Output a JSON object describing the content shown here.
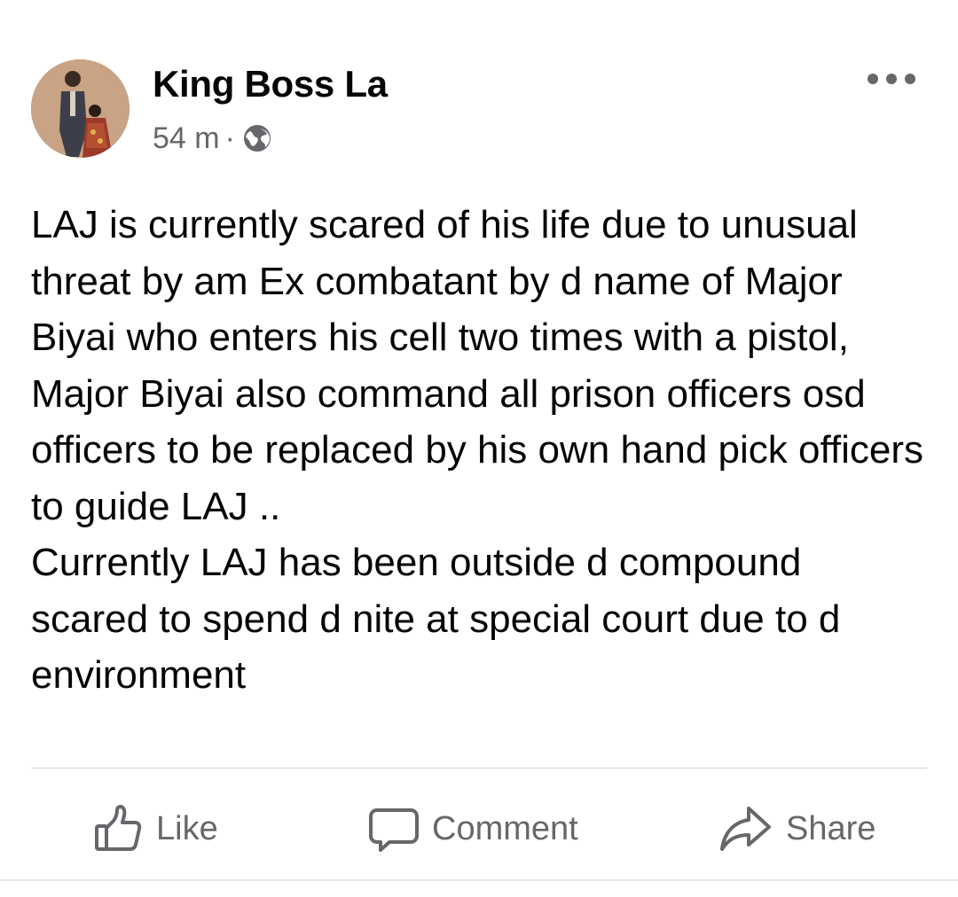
{
  "post": {
    "author": "King Boss La",
    "time": "54 m",
    "separator": "·",
    "privacy_icon": "globe-icon",
    "options_icon": "more-options-icon",
    "text_paragraphs": [
      "LAJ is currently scared of his life due to unusual threat by am Ex combatant by d name of Major Biyai who enters his cell two times with a pistol, Major Biyai also command all prison officers osd officers to be replaced by his own hand pick officers to guide LAJ ..",
      "Currently LAJ has been outside d compound scared to spend d nite at special court due to d environment"
    ]
  },
  "actions": {
    "like": {
      "label": "Like",
      "icon": "thumbs-up-icon"
    },
    "comment": {
      "label": "Comment",
      "icon": "comment-bubble-icon"
    },
    "share": {
      "label": "Share",
      "icon": "share-arrow-icon"
    }
  },
  "colors": {
    "text_primary": "#050505",
    "text_secondary": "#65676b",
    "divider": "#ced0d4"
  }
}
